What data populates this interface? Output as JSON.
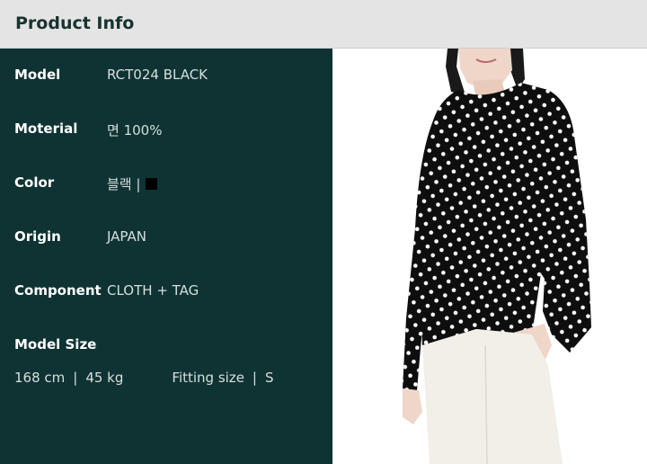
{
  "header": {
    "title": "Product Info"
  },
  "details": [
    {
      "label": "Model",
      "value": "RCT024 BLACK"
    },
    {
      "label": "Moterial",
      "value": "면 100%"
    },
    {
      "label": "Color",
      "value": "블랙 |"
    },
    {
      "label": "Origin",
      "value": "JAPAN"
    },
    {
      "label": "Component",
      "value": "CLOTH + TAG"
    }
  ],
  "color_swatch": "#000000",
  "model_size": {
    "label": "Model Size",
    "height": "168 cm",
    "sep1": "|",
    "weight": "45 kg",
    "fitting_label": "Fitting size",
    "sep2": "|",
    "fitting_value": "S"
  },
  "photo": {
    "subject": "model-wearing-black-polka-dot-long-sleeve-top"
  }
}
